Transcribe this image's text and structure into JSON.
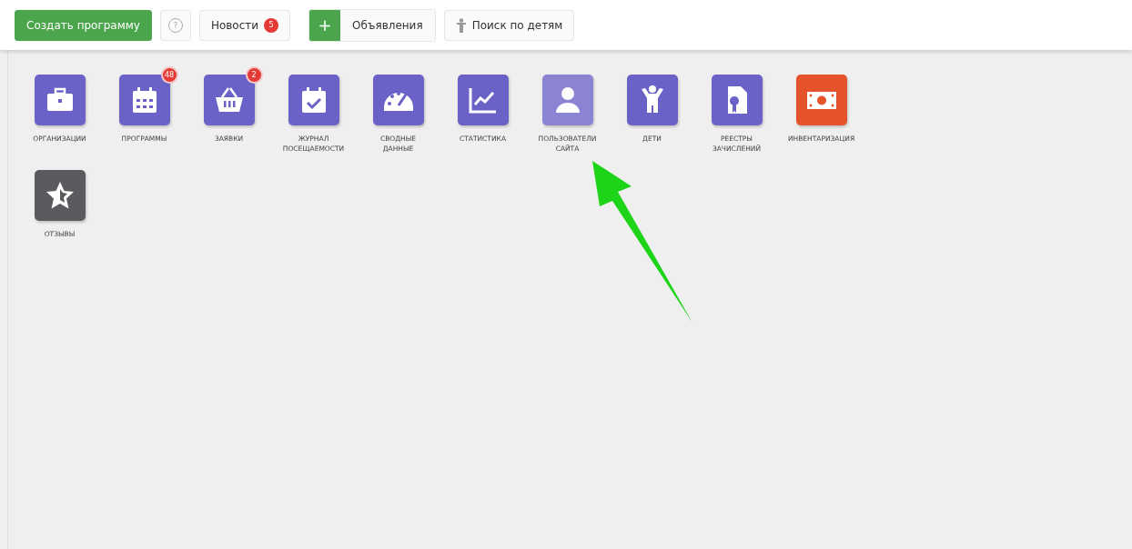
{
  "toolbar": {
    "create_button": "Создать программу",
    "help_icon": "?",
    "news": {
      "label": "Новости",
      "badge": "5"
    },
    "announcements": {
      "icon": "+",
      "label": "Объявления"
    },
    "child_search": "Поиск по детям"
  },
  "tiles": [
    {
      "kind": "briefcase",
      "color": "#6a62c6",
      "lines": [
        "ОРГАНИЗАЦИИ"
      ]
    },
    {
      "kind": "calendar",
      "color": "#6a62c6",
      "lines": [
        "ПРОГРАММЫ"
      ],
      "badge": "48"
    },
    {
      "kind": "basket",
      "color": "#6a62c6",
      "lines": [
        "ЗАЯВКИ"
      ],
      "badge": "2"
    },
    {
      "kind": "calendar-check",
      "color": "#6a62c6",
      "lines": [
        "ЖУРНАЛ",
        "ПОСЕЩАЕМОСТИ"
      ]
    },
    {
      "kind": "gauge",
      "color": "#6a62c6",
      "lines": [
        "СВОДНЫЕ",
        "ДАННЫЕ"
      ]
    },
    {
      "kind": "chart",
      "color": "#6a62c6",
      "lines": [
        "СТАТИСТИКА"
      ]
    },
    {
      "kind": "user",
      "color": "#8a84d2",
      "lines": [
        "ПОЛЬЗОВАТЕЛИ",
        "САЙТА"
      ]
    },
    {
      "kind": "child",
      "color": "#6a62c6",
      "lines": [
        "ДЕТИ"
      ]
    },
    {
      "kind": "certificate",
      "color": "#6a62c6",
      "lines": [
        "РЕЕСТРЫ",
        "ЗАЧИСЛЕНИЙ"
      ]
    },
    {
      "kind": "money",
      "color": "#e5532b",
      "lines": [
        "ИНВЕНТАРИЗАЦИЯ"
      ]
    },
    {
      "kind": "star",
      "color": "#5c5a5e",
      "lines": [
        "ОТЗЫВЫ"
      ]
    }
  ]
}
